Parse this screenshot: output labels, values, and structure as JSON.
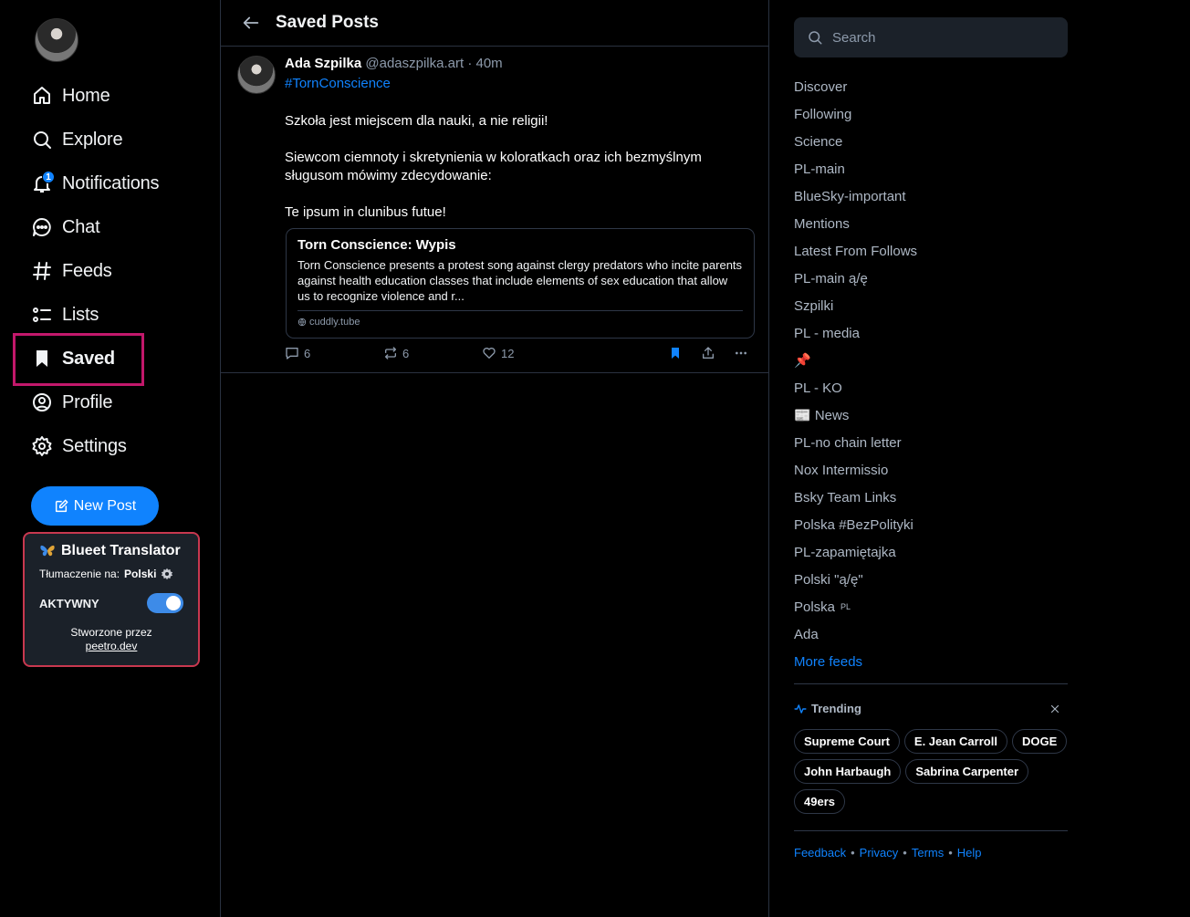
{
  "nav": {
    "items": [
      {
        "label": "Home",
        "icon": "home-icon"
      },
      {
        "label": "Explore",
        "icon": "search-icon"
      },
      {
        "label": "Notifications",
        "icon": "bell-icon",
        "badge": "1"
      },
      {
        "label": "Chat",
        "icon": "chat-icon"
      },
      {
        "label": "Feeds",
        "icon": "hash-icon"
      },
      {
        "label": "Lists",
        "icon": "list-icon"
      },
      {
        "label": "Saved",
        "icon": "bookmark-icon",
        "active": true
      },
      {
        "label": "Profile",
        "icon": "profile-icon"
      },
      {
        "label": "Settings",
        "icon": "gear-icon"
      }
    ],
    "new_post_label": "New Post"
  },
  "translator": {
    "title": "Blueet Translator",
    "lang_prefix": "Tłumaczenie na:",
    "lang_value": "Polski",
    "active_label": "AKTYWNY",
    "active": true,
    "credit_prefix": "Stworzone przez",
    "credit_link": "peetro.dev"
  },
  "header": {
    "title": "Saved Posts"
  },
  "post": {
    "author": "Ada Szpilka",
    "handle": "@adaszpilka.art",
    "time": "40m",
    "tag": "#TornConscience",
    "body": [
      "Szkoła jest miejscem dla nauki, a nie religii!",
      "Siewcom ciemnoty i skretynienia w koloratkach oraz ich bezmyślnym sługusom mówimy zdecydowanie:",
      "Te ipsum in clunibus futue!"
    ],
    "embed": {
      "title": "Torn Conscience: Wypis",
      "description": "Torn Conscience presents a protest song against clergy predators who incite parents against health education classes that include elements of sex education that allow us to recognize violence and r...",
      "domain": "cuddly.tube"
    },
    "replies": "6",
    "reposts": "6",
    "likes": "12"
  },
  "search": {
    "placeholder": "Search"
  },
  "feeds": [
    {
      "label": "Discover"
    },
    {
      "label": "Following"
    },
    {
      "label": "Science"
    },
    {
      "label": "PL-main"
    },
    {
      "label": "BlueSky-important"
    },
    {
      "label": "Mentions"
    },
    {
      "label": "Latest From Follows"
    },
    {
      "label": "PL-main ą/ę"
    },
    {
      "label": "Szpilki"
    },
    {
      "label": "PL - media"
    },
    {
      "label": "📌"
    },
    {
      "label": "PL - KO"
    },
    {
      "label": "📰 News"
    },
    {
      "label": "PL-no chain letter"
    },
    {
      "label": "Nox Intermissio"
    },
    {
      "label": "Bsky Team Links"
    },
    {
      "label": "Polska #BezPolityki"
    },
    {
      "label": "PL-zapamiętajka"
    },
    {
      "label": "Polski \"ą/ę\""
    },
    {
      "label": "Polska",
      "suffix": "PL"
    },
    {
      "label": "Ada"
    }
  ],
  "more_feeds_label": "More feeds",
  "trending": {
    "title": "Trending",
    "topics": [
      "Supreme Court",
      "E. Jean Carroll",
      "DOGE",
      "John Harbaugh",
      "Sabrina Carpenter",
      "49ers"
    ]
  },
  "footer": {
    "feedback": "Feedback",
    "privacy": "Privacy",
    "terms": "Terms",
    "help": "Help"
  },
  "colors": {
    "accent": "#1083fe",
    "highlight": "#c2186b",
    "translator_border": "#c8384f"
  }
}
